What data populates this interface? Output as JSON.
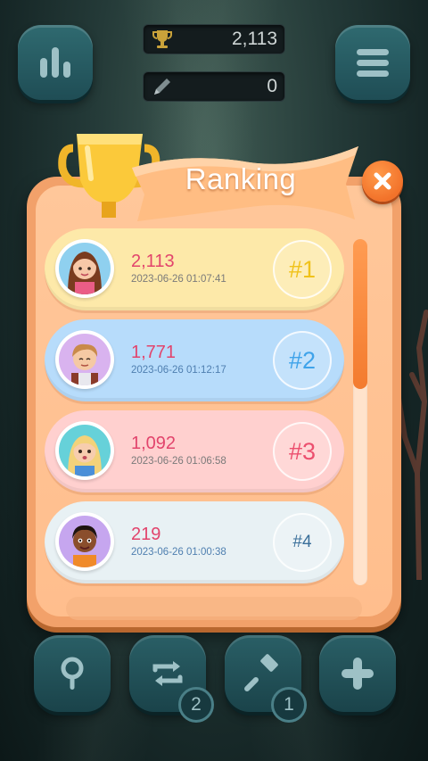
{
  "header": {
    "high_score": "2,113",
    "moves": "0",
    "icons": {
      "stats": "bar-chart-icon",
      "menu": "hamburger-menu-icon",
      "trophy": "trophy-icon",
      "pencil": "pencil-icon"
    }
  },
  "dialog": {
    "title": "Ranking",
    "close_icon": "close-icon",
    "entries": [
      {
        "score": "2,113",
        "time": "2023-06-26 01:07:41",
        "rank": "#1",
        "bg": "#fde9a9",
        "rank_color": "#f0c21a",
        "time_color": "#7a7a7a"
      },
      {
        "score": "1,771",
        "time": "2023-06-26 01:12:17",
        "rank": "#2",
        "bg": "#b7dcfb",
        "rank_color": "#3fa3ea",
        "time_color": "#4f7fb0"
      },
      {
        "score": "1,092",
        "time": "2023-06-26 01:06:58",
        "rank": "#3",
        "bg": "#ffd0cf",
        "rank_color": "#ec4f6e",
        "time_color": "#7a7a7a"
      },
      {
        "score": "219",
        "time": "2023-06-26 01:00:38",
        "rank": "#4",
        "bg": "#e8f1f4",
        "rank_color": "#3a6f9a",
        "time_color": "#4f7fb0"
      }
    ],
    "scroll_position": 0.0
  },
  "toolbar": {
    "hint_icon": "magnifier-icon",
    "swap_icon": "shuffle-arrows-icon",
    "swap_count": "2",
    "hammer_icon": "hammer-icon",
    "hammer_count": "1",
    "add_icon": "plus-icon"
  },
  "colors": {
    "accent": "#f2722a",
    "panel": "#ffc79a",
    "button": "#2a5f66"
  }
}
